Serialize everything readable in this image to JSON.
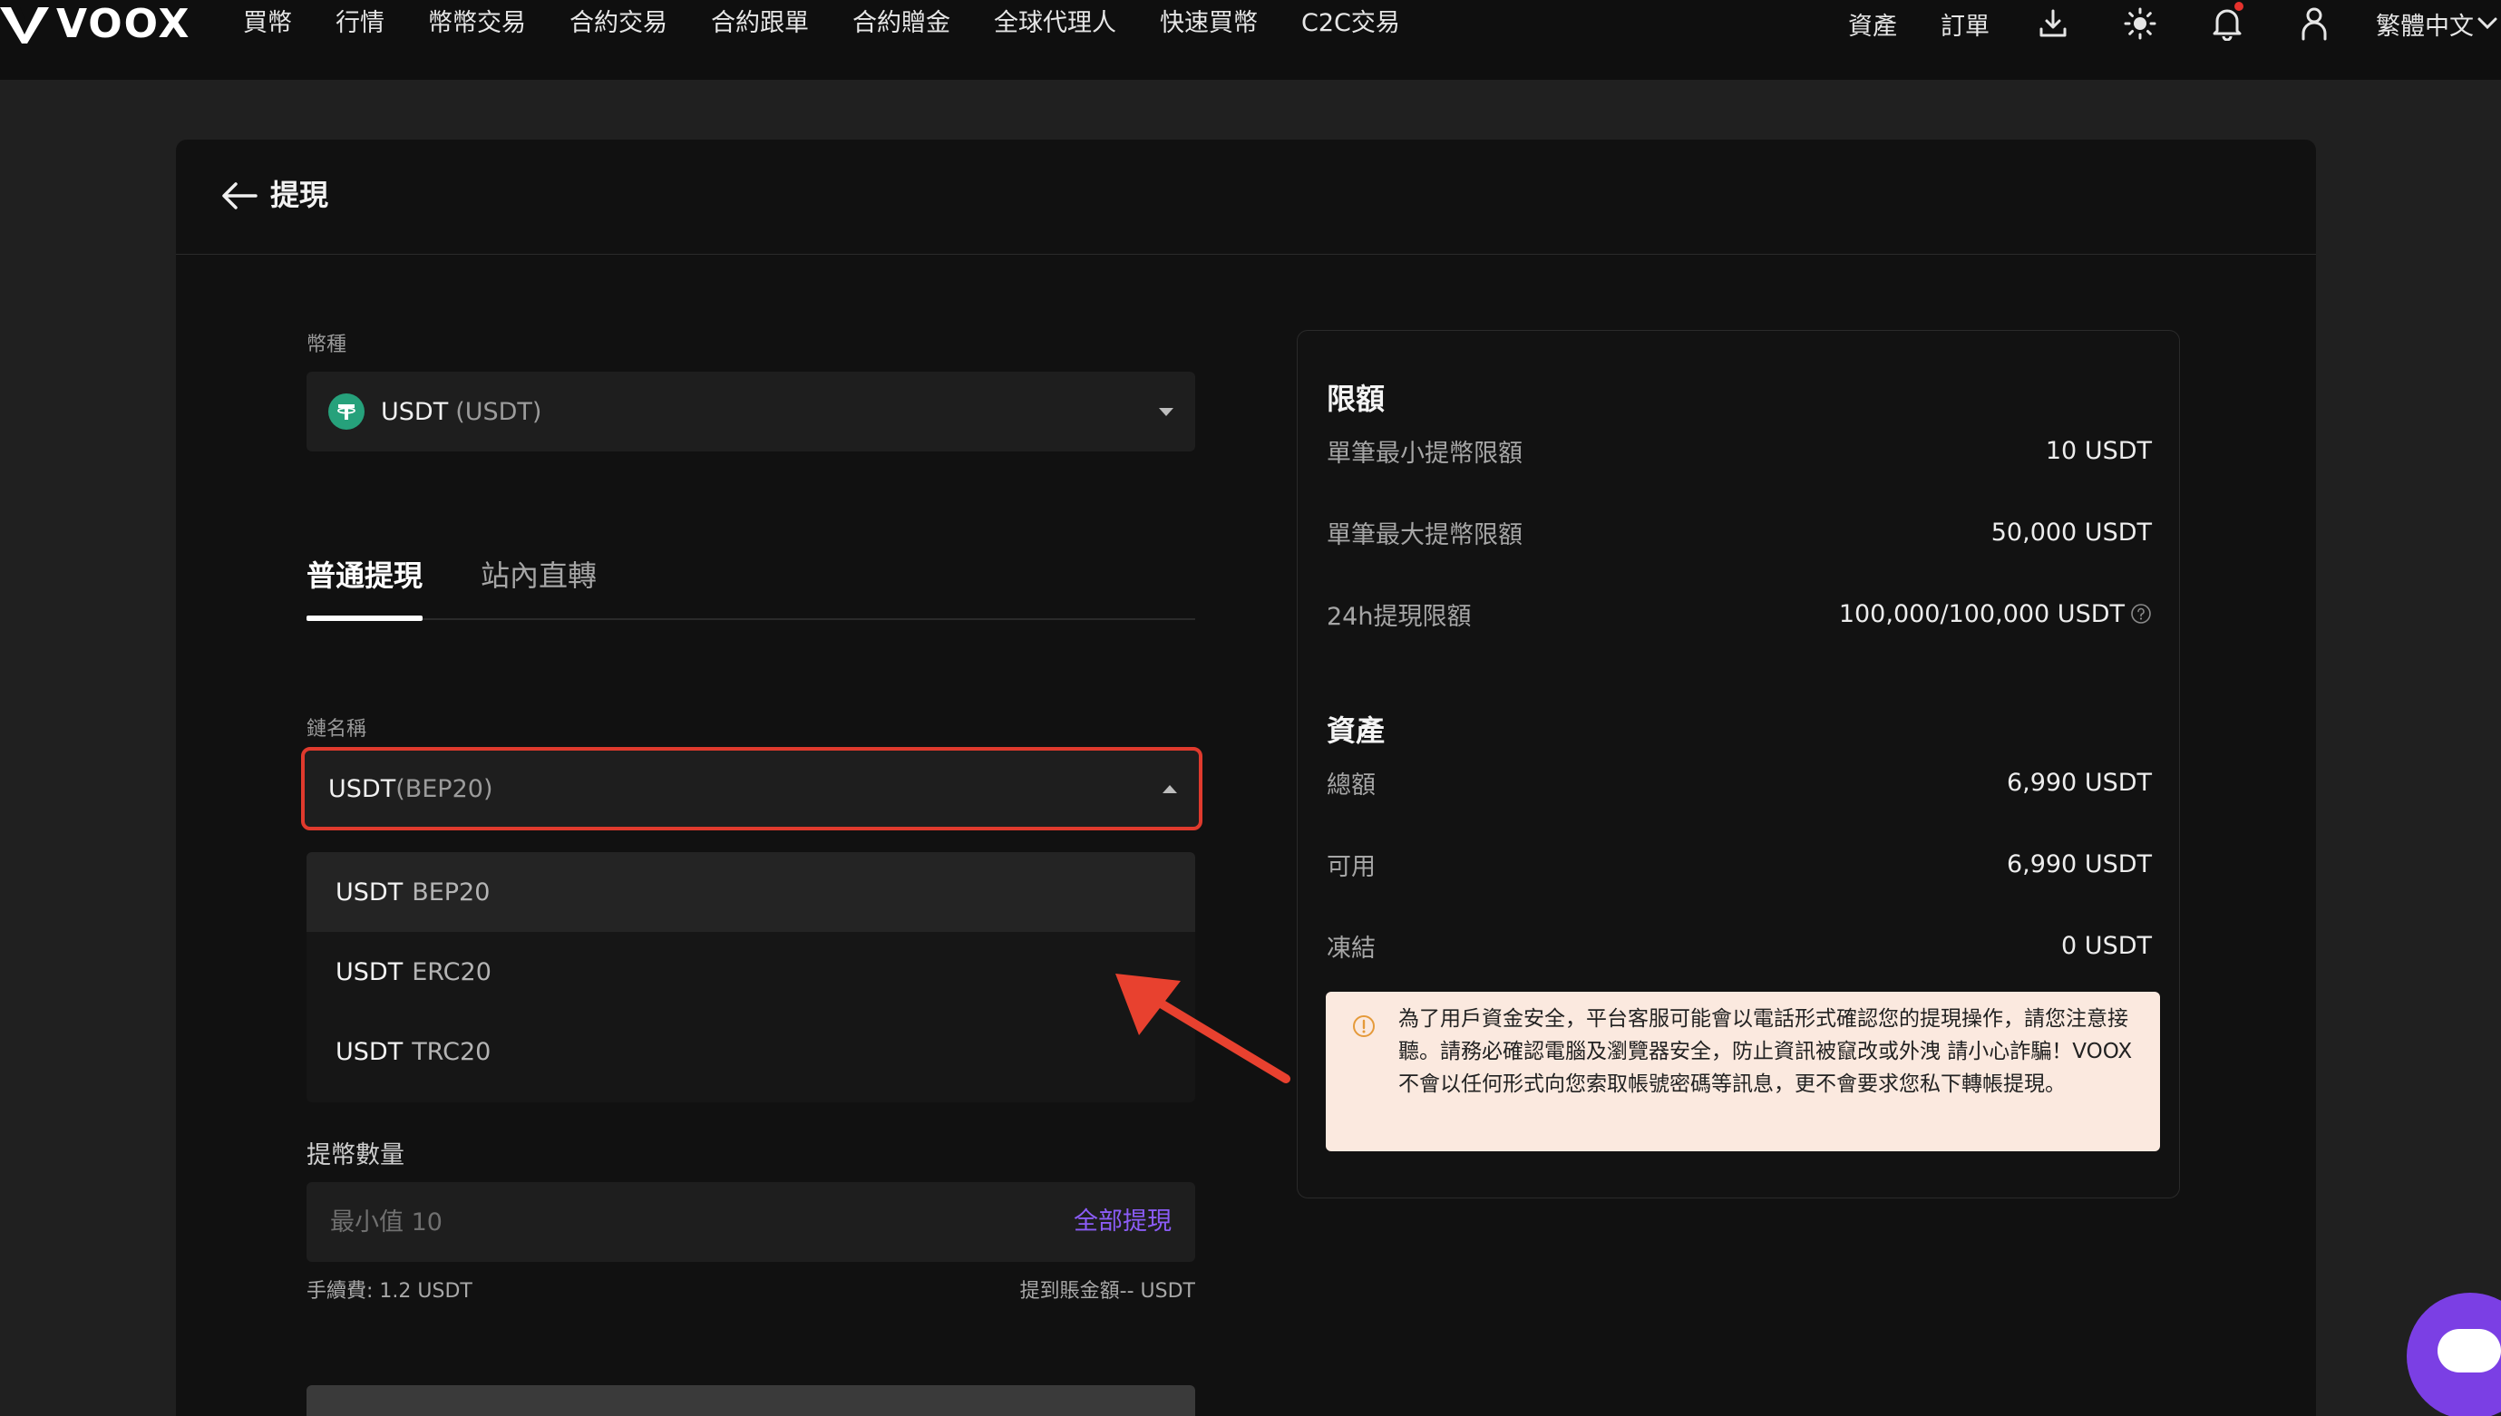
{
  "nav": {
    "brand": "VOOX",
    "menu": [
      "買幣",
      "行情",
      "幣幣交易",
      "合約交易",
      "合約跟單",
      "合約贈金",
      "全球代理人",
      "快速買幣",
      "C2C交易"
    ],
    "assets_label": "資產",
    "orders_label": "訂單",
    "language_label": "繁體中文"
  },
  "page": {
    "title": "提現"
  },
  "form": {
    "coin_label": "幣種",
    "coin_value": "USDT",
    "coin_sub": "(USDT)",
    "tabs": [
      "普通提現",
      "站內直轉"
    ],
    "chain_label": "鏈名稱",
    "chain_value_main": "USDT",
    "chain_value_sub": "(BEP20)",
    "chain_options": [
      {
        "main": "USDT",
        "sub": "BEP20"
      },
      {
        "main": "USDT",
        "sub": "ERC20"
      },
      {
        "main": "USDT",
        "sub": "TRC20"
      }
    ],
    "amount_label": "提幣數量",
    "amount_placeholder": "最小值 10",
    "withdraw_all": "全部提現",
    "fee": "手續費: 1.2 USDT",
    "receive": "提到賬金額-- USDT"
  },
  "limits": {
    "title": "限額",
    "rows": [
      {
        "label": "單筆最小提幣限額",
        "value": "10 USDT"
      },
      {
        "label": "單筆最大提幣限額",
        "value": "50,000 USDT"
      },
      {
        "label": "24h提現限額",
        "value": "100,000/100,000 USDT"
      }
    ]
  },
  "assets": {
    "title": "資產",
    "rows": [
      {
        "label": "總額",
        "value": "6,990 USDT"
      },
      {
        "label": "可用",
        "value": "6,990 USDT"
      },
      {
        "label": "凍結",
        "value": "0 USDT"
      }
    ]
  },
  "notice": {
    "text": "為了用戶資金安全，平台客服可能會以電話形式確認您的提現操作，請您注意接聽。請務必確認電腦及瀏覽器安全，防止資訊被竄改或外洩 請小心詐騙！VOOX不會以任何形式向您索取帳號密碼等訊息，更不會要求您私下轉帳提現。"
  },
  "colors": {
    "accent_purple": "#8b5cf6",
    "highlight_red": "#e03a2d",
    "tether_green": "#26a17b"
  }
}
